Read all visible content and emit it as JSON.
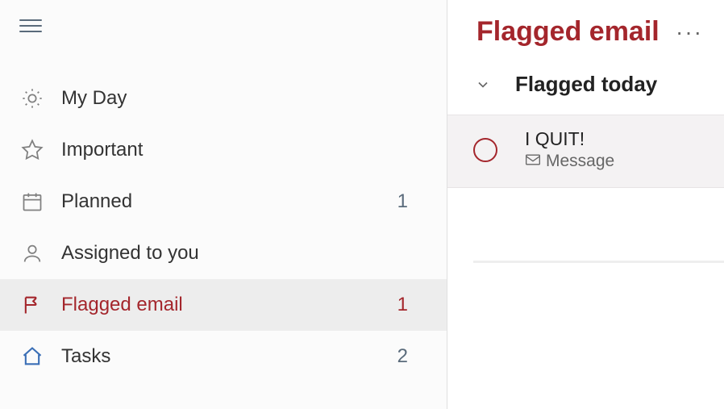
{
  "sidebar": {
    "items": [
      {
        "label": "My Day",
        "count": null
      },
      {
        "label": "Important",
        "count": null
      },
      {
        "label": "Planned",
        "count": "1"
      },
      {
        "label": "Assigned to you",
        "count": null
      },
      {
        "label": "Flagged email",
        "count": "1"
      },
      {
        "label": "Tasks",
        "count": "2"
      }
    ]
  },
  "main": {
    "title": "Flagged email",
    "group_title": "Flagged today",
    "task": {
      "title": "I QUIT!",
      "meta": "Message"
    }
  },
  "colors": {
    "accent": "#a4262c"
  }
}
